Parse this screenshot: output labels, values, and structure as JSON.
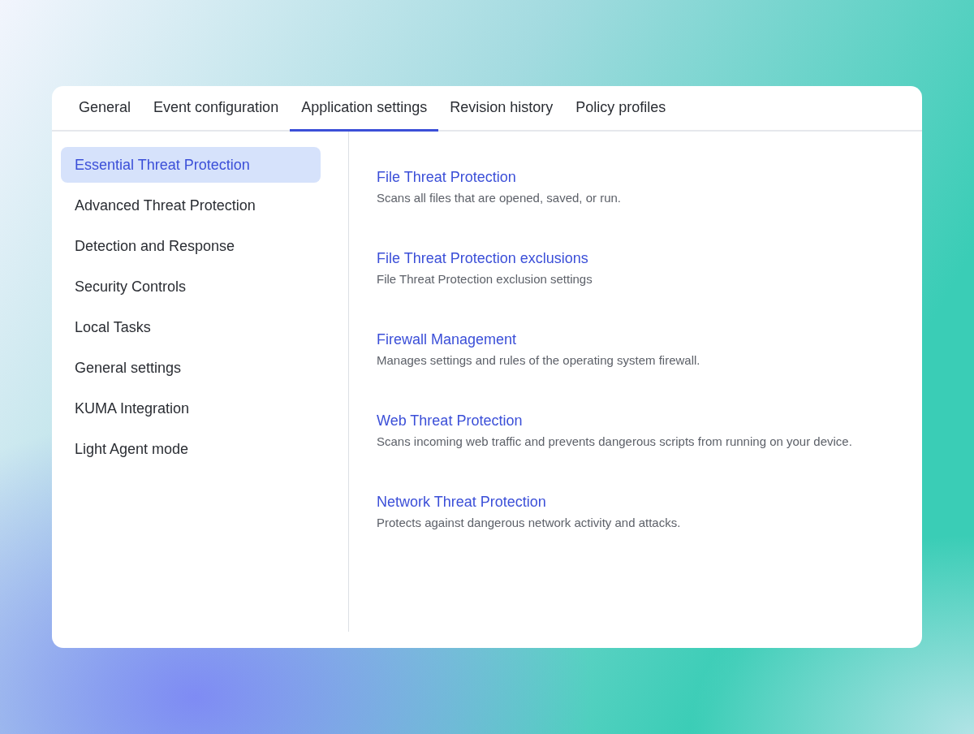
{
  "tabs": [
    {
      "label": "General",
      "selected": false
    },
    {
      "label": "Event configuration",
      "selected": false
    },
    {
      "label": "Application settings",
      "selected": true
    },
    {
      "label": "Revision history",
      "selected": false
    },
    {
      "label": "Policy profiles",
      "selected": false
    }
  ],
  "sidebar": {
    "items": [
      {
        "label": "Essential Threat Protection",
        "selected": true
      },
      {
        "label": "Advanced Threat Protection",
        "selected": false
      },
      {
        "label": "Detection and Response",
        "selected": false
      },
      {
        "label": "Security Controls",
        "selected": false
      },
      {
        "label": "Local Tasks",
        "selected": false
      },
      {
        "label": "General settings",
        "selected": false
      },
      {
        "label": "KUMA Integration",
        "selected": false
      },
      {
        "label": "Light Agent mode",
        "selected": false
      }
    ]
  },
  "sections": [
    {
      "title": "File Threat Protection",
      "description": "Scans all files that are opened, saved, or run."
    },
    {
      "title": "File Threat Protection exclusions",
      "description": "File Threat Protection exclusion settings"
    },
    {
      "title": "Firewall Management",
      "description": "Manages settings and rules of the operating system firewall."
    },
    {
      "title": "Web Threat Protection",
      "description": "Scans incoming web traffic and prevents dangerous scripts from running on your device."
    },
    {
      "title": "Network Threat Protection",
      "description": "Protects against dangerous network activity and attacks."
    }
  ]
}
